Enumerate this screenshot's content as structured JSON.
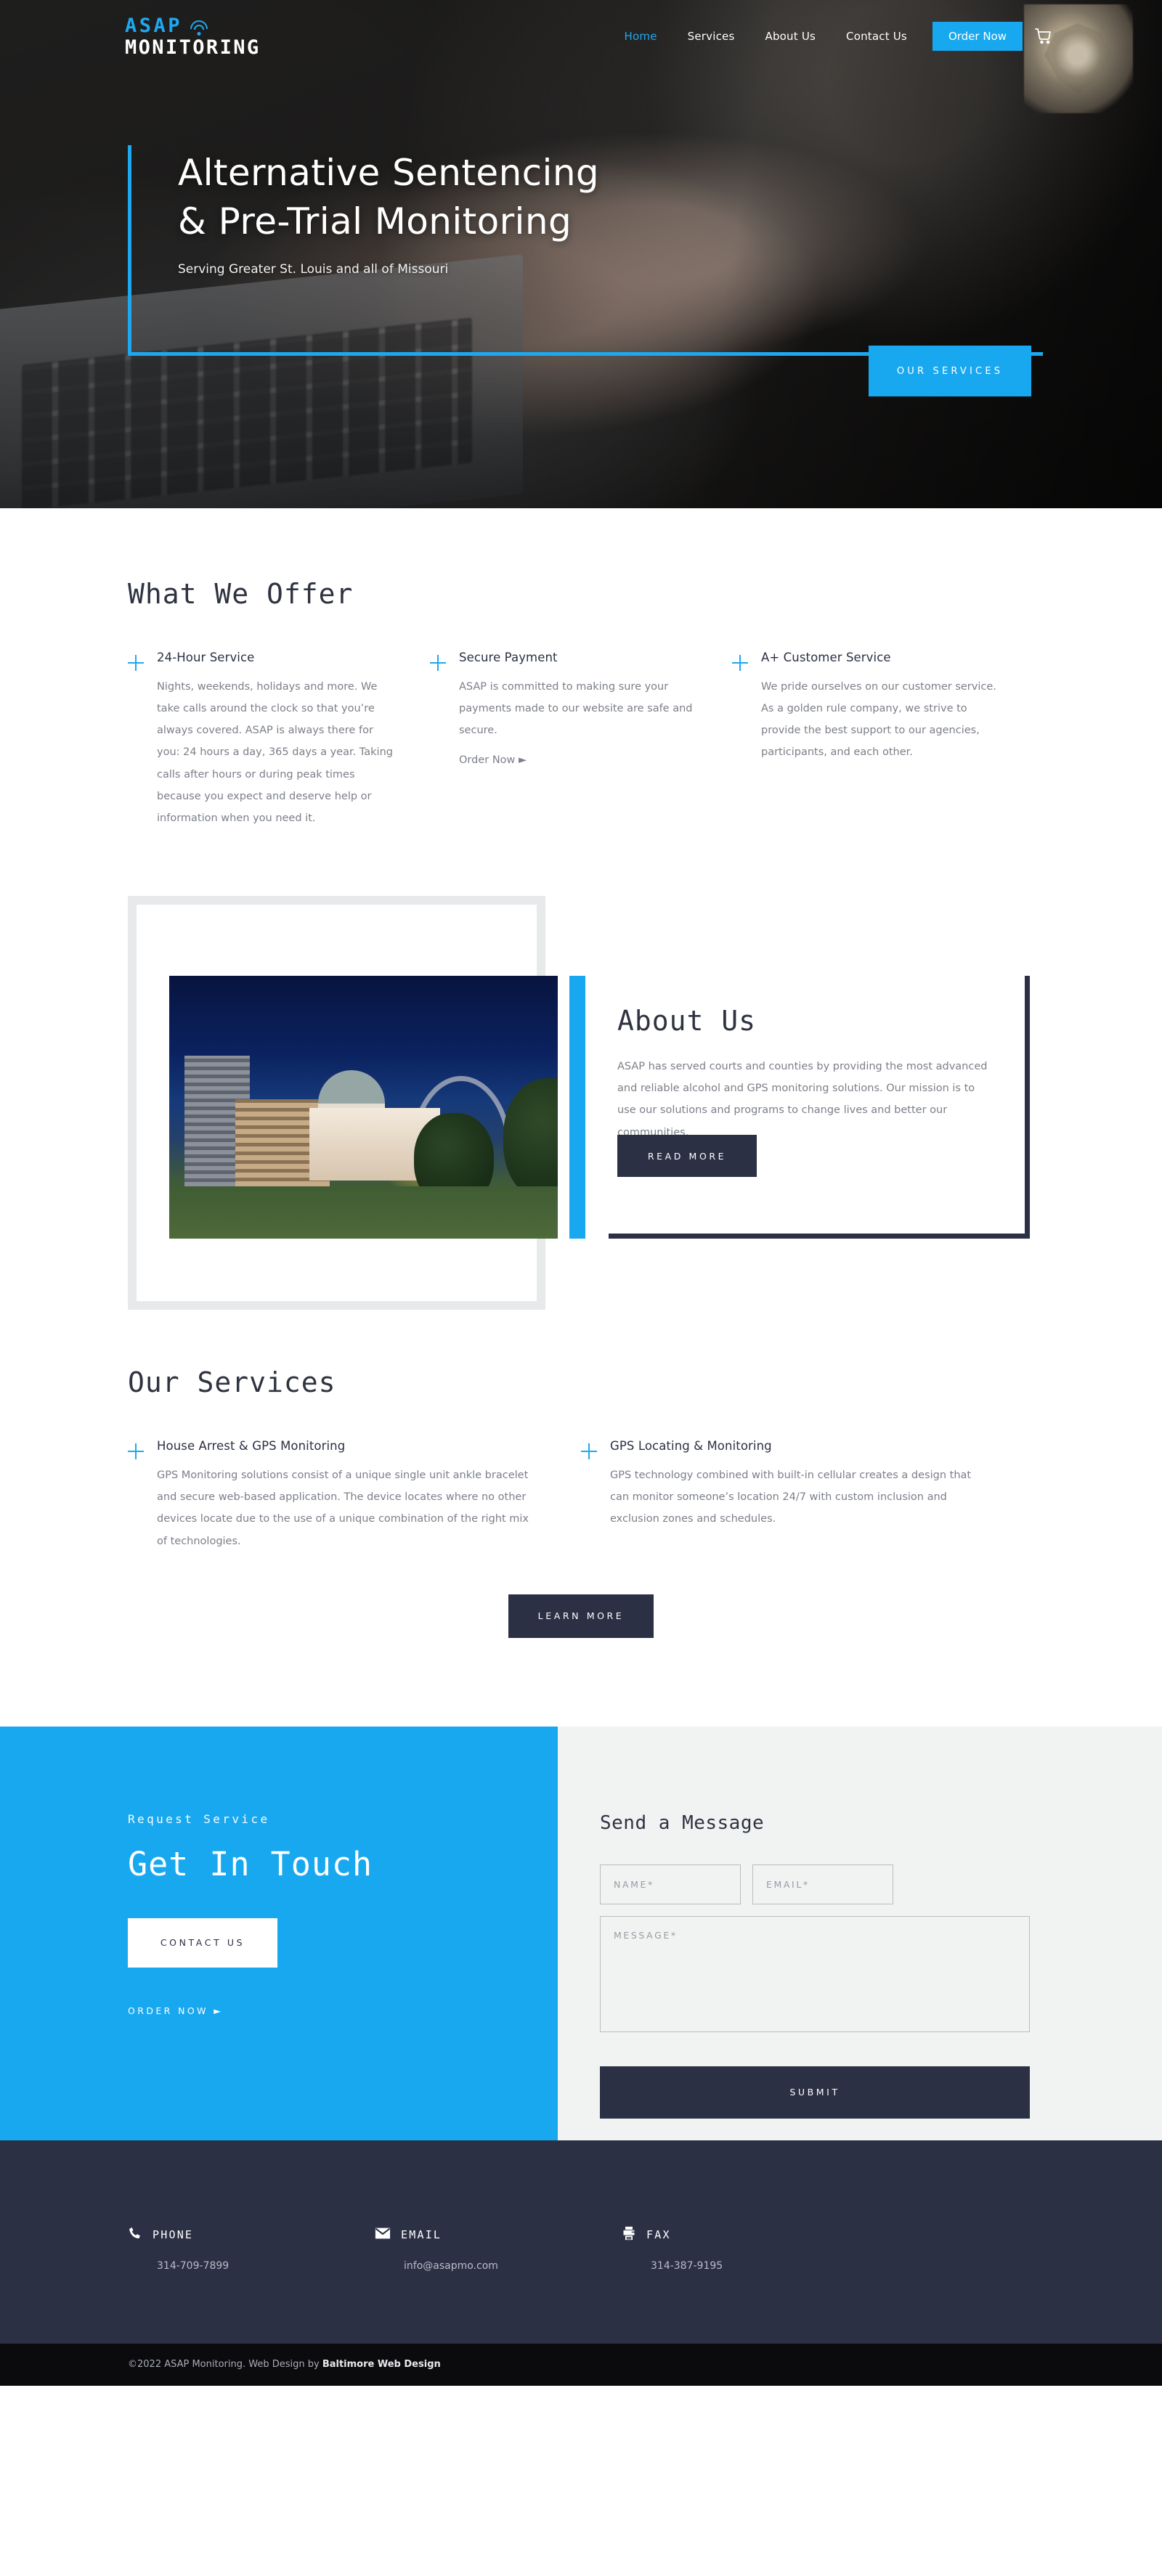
{
  "header": {
    "logo_primary": "ASAP",
    "logo_secondary": "MONITORING",
    "nav": [
      {
        "label": "Home",
        "active": true
      },
      {
        "label": "Services",
        "active": false
      },
      {
        "label": "About Us",
        "active": false
      },
      {
        "label": "Contact Us",
        "active": false
      }
    ],
    "order_button": "Order Now",
    "cart_icon": "shopping-cart-icon"
  },
  "hero": {
    "title_line1": "Alternative Sentencing",
    "title_line2": "& Pre-Trial Monitoring",
    "subtitle": "Serving Greater St. Louis and all of Missouri",
    "cta": "OUR SERVICES",
    "accent_color": "#18a8ef"
  },
  "offer": {
    "heading": "What We Offer",
    "items": [
      {
        "title": "24-Hour Service",
        "body": "Nights, weekends, holidays and more. We take calls around the clock so that you’re always covered.  ASAP is always there for you: 24 hours a day, 365 days a year. Taking calls after hours or during peak times because you expect and deserve help or information when you need it.",
        "link": ""
      },
      {
        "title": "Secure Payment",
        "body": "ASAP is committed to making sure your payments made to our website are safe and secure.",
        "link": "Order Now ►"
      },
      {
        "title": "A+ Customer Service",
        "body": "We pride ourselves on our customer service. As a golden rule company, we strive to provide the best support to our agencies, participants, and each other.",
        "link": ""
      }
    ]
  },
  "about": {
    "heading": "About Us",
    "body": "ASAP has served courts and counties by providing the most advanced and reliable alcohol and GPS monitoring solutions. Our mission is to use our solutions and programs to change lives and better our communities.",
    "button": "READ MORE",
    "image_alt": "st-louis-old-courthouse-gateway-arch-night-photo"
  },
  "services": {
    "heading": "Our Services",
    "items": [
      {
        "title": "House Arrest & GPS Monitoring",
        "body": "GPS Monitoring solutions consist of a unique single unit ankle bracelet and secure web-based application. The device locates where no other devices locate due to the use of a unique combination of the right mix of technologies."
      },
      {
        "title": "GPS Locating & Monitoring",
        "body": "GPS technology combined with built-in cellular creates a design that can monitor someone’s location 24/7 with custom inclusion and exclusion zones and schedules."
      }
    ],
    "button": "LEARN MORE"
  },
  "contact": {
    "eyebrow": "Request Service",
    "heading": "Get In Touch",
    "button": "CONTACT US",
    "order_link": "ORDER NOW  ►",
    "panel_color": "#18a8ef",
    "form": {
      "title": "Send a Message",
      "name_placeholder": "NAME*",
      "name_value": "",
      "email_placeholder": "EMAIL*",
      "email_value": "",
      "message_placeholder": "MESSAGE*",
      "message_value": "",
      "submit": "SUBMIT"
    }
  },
  "footer": {
    "columns": [
      {
        "icon": "phone-icon",
        "label": "PHONE",
        "value": "314-709-7899"
      },
      {
        "icon": "email-icon",
        "label": "EMAIL",
        "value": "info@asapmo.com"
      },
      {
        "icon": "fax-icon",
        "label": "FAX",
        "value": "314-387-9195"
      }
    ],
    "copyright_prefix": "©2022 ASAP Monitoring. Web Design by ",
    "copyright_link": "Baltimore Web Design",
    "background_color": "#2b3044"
  }
}
